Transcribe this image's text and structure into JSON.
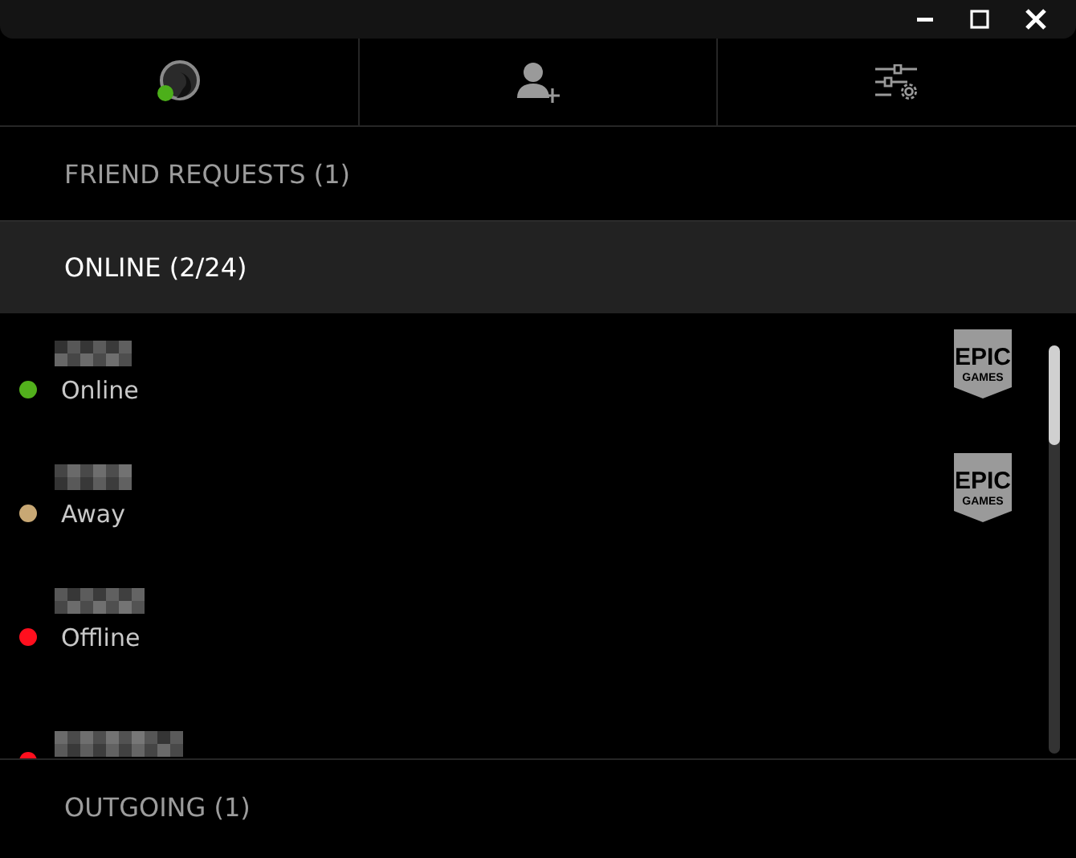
{
  "window": {
    "controls": [
      {
        "kind": "minimize"
      },
      {
        "kind": "maximize"
      },
      {
        "kind": "close"
      }
    ]
  },
  "tabs": [
    {
      "kind": "presence",
      "color": "#4caf1a"
    },
    {
      "kind": "add_friend"
    },
    {
      "kind": "settings"
    }
  ],
  "sections": [
    {
      "label": "FRIEND REQUESTS (1)",
      "expanded": false
    },
    {
      "label": "ONLINE (2/24)",
      "expanded": true
    }
  ],
  "friends": [
    {
      "status": "Online",
      "color": "#52b01c",
      "logo": {
        "top": "EPIC",
        "bottom": "GAMES"
      }
    },
    {
      "status": "Away",
      "color": "#c8a874",
      "logo": {
        "top": "EPIC",
        "bottom": "GAMES"
      }
    },
    {
      "status": "Offline",
      "color": "#ff0f1e"
    },
    {
      "color": "#ff0f1e"
    }
  ],
  "footer_section": {
    "label": "OUTGOING (1)",
    "expanded": false
  }
}
